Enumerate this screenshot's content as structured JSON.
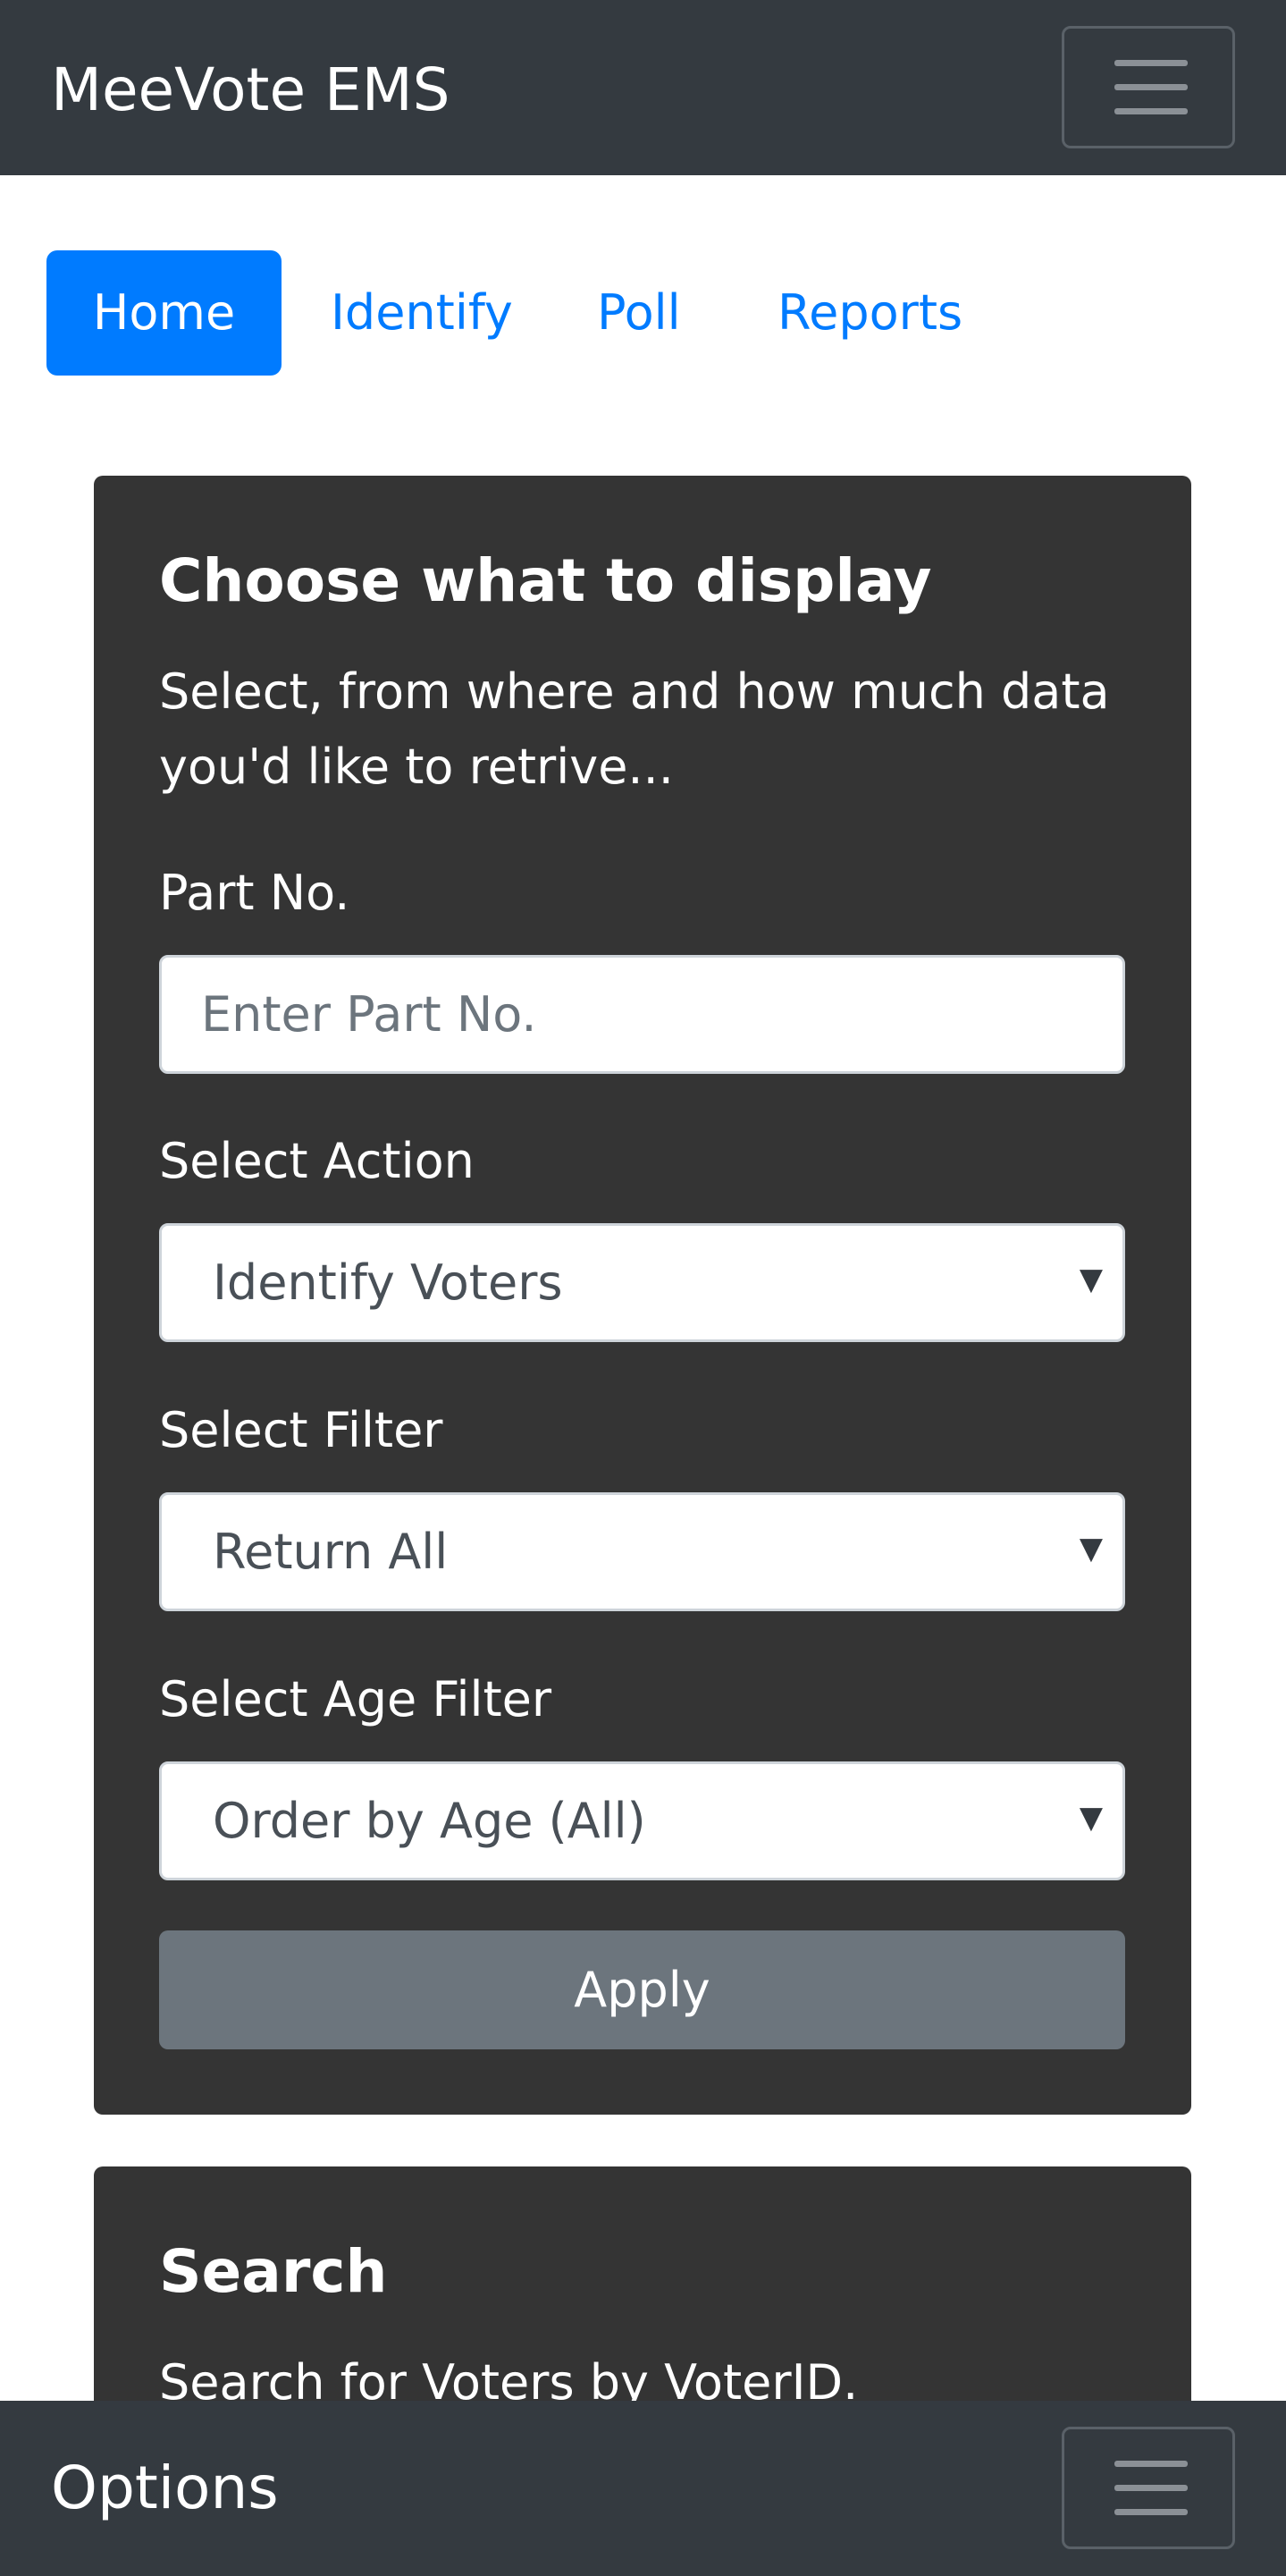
{
  "header": {
    "brand": "MeeVote EMS",
    "toggler_icon": "hamburger-menu-icon"
  },
  "nav": {
    "tabs": [
      {
        "label": "Home",
        "active": true
      },
      {
        "label": "Identify",
        "active": false
      },
      {
        "label": "Poll",
        "active": false
      },
      {
        "label": "Reports",
        "active": false
      }
    ]
  },
  "display_card": {
    "title": "Choose what to display",
    "text_line1": "Select, from where and how much data",
    "text_line2": "you'd like to retrive...",
    "part_no": {
      "label": "Part No.",
      "placeholder": "Enter Part No.",
      "value": ""
    },
    "action": {
      "label": "Select Action",
      "selected": "Identify Voters"
    },
    "filter": {
      "label": "Select Filter",
      "selected": "Return All"
    },
    "age_filter": {
      "label": "Select Age Filter",
      "selected": "Order by Age (All)"
    },
    "apply_label": "Apply",
    "caret": "▼"
  },
  "search_card": {
    "title": "Search",
    "text": "Search for Voters by VoterID."
  },
  "footer": {
    "title": "Options",
    "toggler_icon": "hamburger-menu-icon"
  },
  "colors": {
    "navbar": "#343a40",
    "card": "#343434",
    "primary": "#007bff",
    "secondary_button": "#6c757d"
  }
}
